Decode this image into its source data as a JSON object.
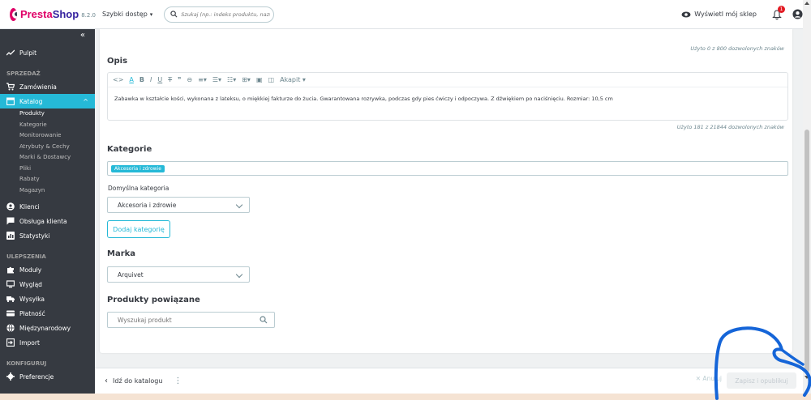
{
  "header": {
    "logo_presta": "Presta",
    "logo_shop": "Shop",
    "version": "8.2.0",
    "quick_access": "Szybki dostęp",
    "search_placeholder": "Szukaj (np.: indeks produktu, nazwa k",
    "view_shop": "Wyświetl mój sklep",
    "notifications_count": "1"
  },
  "sidebar": {
    "collapse": "«",
    "dashboard": "Pulpit",
    "section_sell": "SPRZEDAŻ",
    "orders": "Zamówienia",
    "catalog": "Katalog",
    "catalog_sub": [
      "Produkty",
      "Kategorie",
      "Monitorowanie",
      "Atrybuty & Cechy",
      "Marki & Dostawcy",
      "Pliki",
      "Rabaty",
      "Magazyn"
    ],
    "customers": "Klienci",
    "customer_service": "Obsługa klienta",
    "stats": "Statystyki",
    "section_improve": "ULEPSZENIA",
    "modules": "Moduły",
    "design": "Wygląd",
    "shipping": "Wysyłka",
    "payment": "Płatność",
    "international": "Międzynarodowy",
    "import": "Import",
    "section_configure": "KONFIGURUJ",
    "preferences": "Preferencje"
  },
  "main": {
    "summary_counter": "Użyto 0 z 800 dozwolonych znaków",
    "description_heading": "Opis",
    "toolbar_paragraph": "Akapit",
    "description_text": "Zabawka w kształcie kości, wykonana z lateksu, o miękkiej fakturze do żucia. Gwarantowana rozrywka, podczas gdy pies ćwiczy i odpoczywa. Z dźwiękiem po naciśnięciu. Rozmiar: 10,5 cm",
    "description_counter": "Użyto 181 z 21844 dozwolonych znaków",
    "categories_heading": "Kategorie",
    "category_tag": "Akcesoria i zdrowie",
    "default_category_label": "Domyślna kategoria",
    "default_category_value": "Akcesoria i zdrowie",
    "add_category_button": "Dodaj kategorię",
    "brand_heading": "Marka",
    "brand_value": "Arquivet",
    "related_heading": "Produkty powiązane",
    "related_placeholder": "Wyszukaj produkt"
  },
  "footer": {
    "back": "Idź do katalogu",
    "more": "⋮",
    "cancel": "✕ Anuluj",
    "publish": "Zapisz i opublikuj"
  },
  "colors": {
    "accent": "#25b9d7",
    "sidebar": "#363a41",
    "brand_pink": "#df0067",
    "scribble": "#1565d8"
  }
}
